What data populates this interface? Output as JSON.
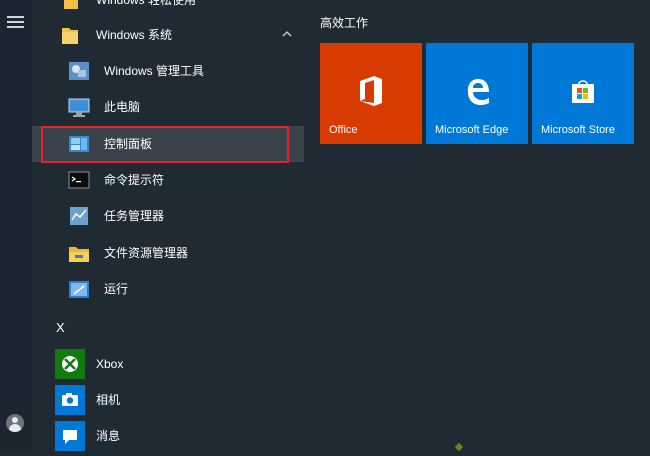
{
  "sidebar": {
    "menu_icon": "hamburger-menu-icon",
    "user_icon": "user-avatar-icon"
  },
  "start_list": {
    "partial_top_item": "Windows 轻松使用",
    "folder": {
      "label": "Windows 系统",
      "icon": "folder-icon",
      "expanded": true
    },
    "items": [
      {
        "label": "Windows 管理工具",
        "icon": "admin-tools-icon"
      },
      {
        "label": "此电脑",
        "icon": "this-pc-icon"
      },
      {
        "label": "控制面板",
        "icon": "control-panel-icon",
        "highlighted": true
      },
      {
        "label": "命令提示符",
        "icon": "command-prompt-icon"
      },
      {
        "label": "任务管理器",
        "icon": "task-manager-icon"
      },
      {
        "label": "文件资源管理器",
        "icon": "file-explorer-icon"
      },
      {
        "label": "运行",
        "icon": "run-icon"
      }
    ],
    "section_letter": "X",
    "x_items": [
      {
        "label": "Xbox",
        "icon": "xbox-icon"
      },
      {
        "label": "相机",
        "icon": "camera-icon"
      },
      {
        "label": "消息",
        "icon": "messaging-icon"
      }
    ]
  },
  "tiles": {
    "group_title": "高效工作",
    "items": [
      {
        "label": "Office",
        "color": "#d83b01",
        "icon": "office-icon"
      },
      {
        "label": "Microsoft Edge",
        "color": "#0078d7",
        "icon": "edge-icon"
      },
      {
        "label": "Microsoft Store",
        "color": "#0078d7",
        "icon": "store-icon"
      }
    ]
  },
  "colors": {
    "background": "#1f2a33",
    "highlight_box": "#e0262b",
    "tile_blue": "#0078d7",
    "tile_orange": "#d83b01",
    "xbox_green": "#107c10"
  }
}
